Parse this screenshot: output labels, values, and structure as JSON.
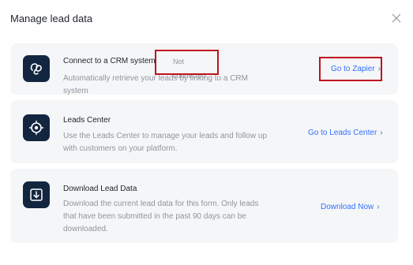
{
  "dialog": {
    "title": "Manage lead data",
    "close_icon": "close-icon"
  },
  "cards": [
    {
      "icon": "crm-link-icon",
      "title": "Connect to a CRM system",
      "badge": "Not connected",
      "description": "Automatically retrieve your leads by linking to a CRM system",
      "action_label": "Go to Zapier",
      "action_icon": "chevron-right-icon"
    },
    {
      "icon": "leads-center-icon",
      "title": "Leads Center",
      "description": "Use the Leads Center to manage your leads and follow up with customers on your platform.",
      "action_label": "Go to Leads Center",
      "action_icon": "chevron-right-icon"
    },
    {
      "icon": "download-icon",
      "title": "Download Lead Data",
      "description": "Download the current lead data for this form. Only leads that have been submitted in the past 90 days can be downloaded.",
      "action_label": "Download Now",
      "action_icon": "chevron-right-icon"
    }
  ],
  "colors": {
    "accent": "#3370ff",
    "icon_bg": "#12263f",
    "card_bg": "#f5f6f7",
    "highlight_box": "#c0111f"
  }
}
